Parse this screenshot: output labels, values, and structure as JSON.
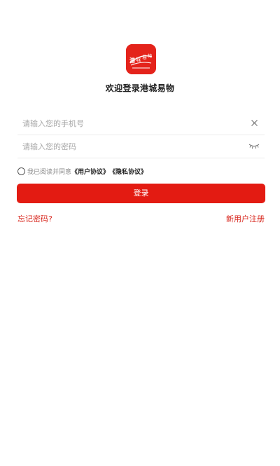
{
  "logo": {
    "icon": "app-logo-icon",
    "text_line1": "港城易物",
    "brand_color": "#e4231b"
  },
  "welcome_text": "欢迎登录港城易物",
  "phone_field": {
    "placeholder": "请输入您的手机号",
    "value": "",
    "icon": "close-icon"
  },
  "password_field": {
    "placeholder": "请输入您的密码",
    "value": "",
    "icon": "eye-closed-icon"
  },
  "agreement": {
    "checked": false,
    "prefix": "我已阅读并同意",
    "user_agreement": "《用户协议》",
    "privacy_policy": "《隐私协议》"
  },
  "login_button": {
    "label": "登录",
    "color": "#e31b12"
  },
  "forgot_password": "忘记密码?",
  "register": "新用户注册",
  "link_color": "#d8281f"
}
